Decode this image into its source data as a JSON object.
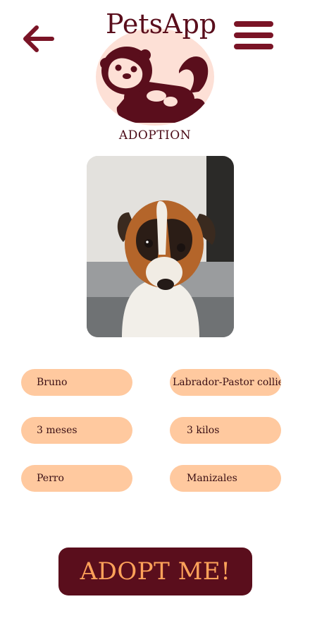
{
  "header": {
    "app_title": "PetsApp",
    "section_label": "ADOPTION",
    "back_icon": "arrow-left-icon",
    "menu_icon": "hamburger-menu-icon",
    "logo_icon": "otter-logo-icon"
  },
  "pet": {
    "photo_subject": "puppy-photo",
    "name": "Bruno",
    "breed": "Labrador-Pastor collie",
    "age": "3 meses",
    "weight": "3 kilos",
    "species": "Perro",
    "city": "Manizales"
  },
  "actions": {
    "adopt_label": "ADOPT ME!"
  },
  "colors": {
    "brand_dark": "#5a0e1c",
    "accent_red": "#7a1426",
    "pill_background": "#ffc99f",
    "button_text": "#ffa25a",
    "logo_background": "#fde0d6"
  }
}
